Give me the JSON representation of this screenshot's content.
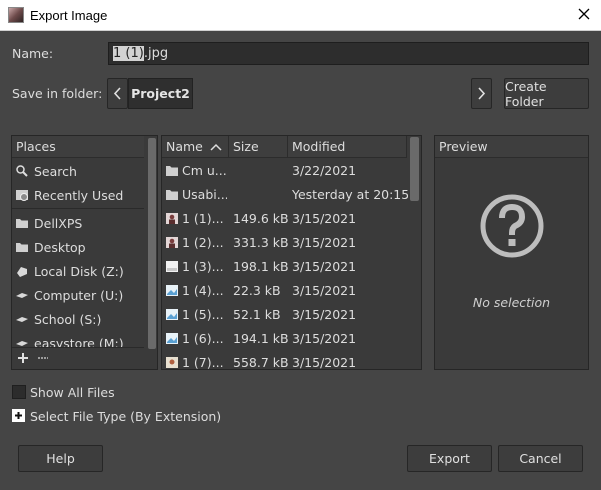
{
  "window": {
    "title": "Export Image",
    "app_icon": "gimp-image-icon",
    "close_icon": "close-icon"
  },
  "name_row": {
    "label": "Name:",
    "selected_part": "1  (1)",
    "rest_part": ".jpg"
  },
  "folder_row": {
    "label": "Save in folder:",
    "current": "Project2",
    "prev_icon": "chevron-left-icon",
    "next_icon": "chevron-right-icon",
    "create_folder": "Create Folder"
  },
  "places": {
    "header": "Places",
    "items": [
      {
        "label": "Search",
        "icon": "search-icon"
      },
      {
        "label": "Recently Used",
        "icon": "recent-icon"
      },
      {
        "label": "DellXPS",
        "icon": "folder-icon"
      },
      {
        "label": "Desktop",
        "icon": "folder-icon"
      },
      {
        "label": "Local Disk (Z:)",
        "icon": "drive-icon"
      },
      {
        "label": "Computer (U:)",
        "icon": "network-drive-icon"
      },
      {
        "label": "School (S:)",
        "icon": "network-drive-icon"
      },
      {
        "label": "easystore (M:)",
        "icon": "network-drive-icon"
      }
    ],
    "add_icon": "plus-icon",
    "remove_icon": "minus-icon"
  },
  "files": {
    "columns": {
      "name": "Name",
      "size": "Size",
      "modified": "Modified"
    },
    "sort_icon": "sort-ascending-icon",
    "rows": [
      {
        "name": "Cm u...",
        "size": "",
        "modified": "3/22/2021",
        "icon": "folder-icon"
      },
      {
        "name": "Usabi...",
        "size": "",
        "modified": "Yesterday at 20:15",
        "icon": "folder-icon"
      },
      {
        "name": "1  (1)...",
        "size": "149.6 kB",
        "modified": "3/15/2021",
        "icon": "image-thumbnail-icon"
      },
      {
        "name": "1  (2)...",
        "size": "331.3 kB",
        "modified": "3/15/2021",
        "icon": "image-thumbnail-icon"
      },
      {
        "name": "1  (3)...",
        "size": "198.1 kB",
        "modified": "3/15/2021",
        "icon": "image-file-icon"
      },
      {
        "name": "1  (4)...",
        "size": "22.3 kB",
        "modified": "3/15/2021",
        "icon": "image-file-icon"
      },
      {
        "name": "1  (5)...",
        "size": "52.1 kB",
        "modified": "3/15/2021",
        "icon": "image-file-icon"
      },
      {
        "name": "1  (6)...",
        "size": "194.1 kB",
        "modified": "3/15/2021",
        "icon": "image-file-icon"
      },
      {
        "name": "1  (7)...",
        "size": "558.7 kB",
        "modified": "3/15/2021",
        "icon": "image-thumbnail-icon"
      }
    ]
  },
  "preview": {
    "header": "Preview",
    "icon": "question-mark-icon",
    "empty_text": "No selection"
  },
  "options": {
    "show_all_files": "Show All Files",
    "show_all_checked": false,
    "select_file_type": "Select File Type (By Extension)",
    "expander_icon": "plus-expander-icon"
  },
  "buttons": {
    "help": "Help",
    "export": "Export",
    "cancel": "Cancel"
  },
  "colors": {
    "background": "#454545",
    "pane": "#3a3a3a",
    "text": "#dddddd",
    "titlebar": "#ffffff"
  }
}
